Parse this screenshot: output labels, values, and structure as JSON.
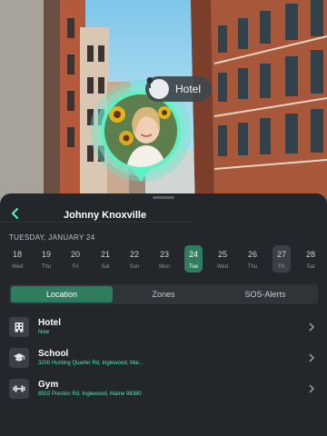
{
  "map": {
    "pin_place_label": "Hotel",
    "pin_icon": "location-pin-icon"
  },
  "sheet": {
    "person_name": "Johnny Knoxville",
    "back_icon": "chevron-left-icon",
    "date_heading": "TUESDAY, JANUARY 24",
    "days": [
      {
        "num": "18",
        "wd": "Wed",
        "state": "normal"
      },
      {
        "num": "19",
        "wd": "Thu",
        "state": "normal"
      },
      {
        "num": "20",
        "wd": "Fri",
        "state": "normal"
      },
      {
        "num": "21",
        "wd": "Sat",
        "state": "normal"
      },
      {
        "num": "22",
        "wd": "Sun",
        "state": "normal"
      },
      {
        "num": "23",
        "wd": "Mon",
        "state": "normal"
      },
      {
        "num": "24",
        "wd": "Tue",
        "state": "selected"
      },
      {
        "num": "25",
        "wd": "Wed",
        "state": "normal"
      },
      {
        "num": "26",
        "wd": "Thu",
        "state": "normal"
      },
      {
        "num": "27",
        "wd": "Fri",
        "state": "marked"
      },
      {
        "num": "28",
        "wd": "Sat",
        "state": "normal"
      }
    ],
    "tabs": [
      {
        "label": "Location",
        "active": true
      },
      {
        "label": "Zones",
        "active": false
      },
      {
        "label": "SOS-Alerts",
        "active": false
      }
    ],
    "places": [
      {
        "title": "Hotel",
        "subtitle": "Now",
        "icon": "building-icon"
      },
      {
        "title": "School",
        "subtitle": "3200 Hunting Quarter Rd, Inglewood, Mai...",
        "icon": "graduation-cap-icon"
      },
      {
        "title": "Gym",
        "subtitle": "8502 Preston Rd. Inglewood, Maine 98380",
        "icon": "dumbbell-icon"
      }
    ],
    "colors": {
      "accent": "#2f7d5f",
      "pin_ring": "#5ff0c4",
      "subtitle": "#5ce0b6"
    }
  }
}
